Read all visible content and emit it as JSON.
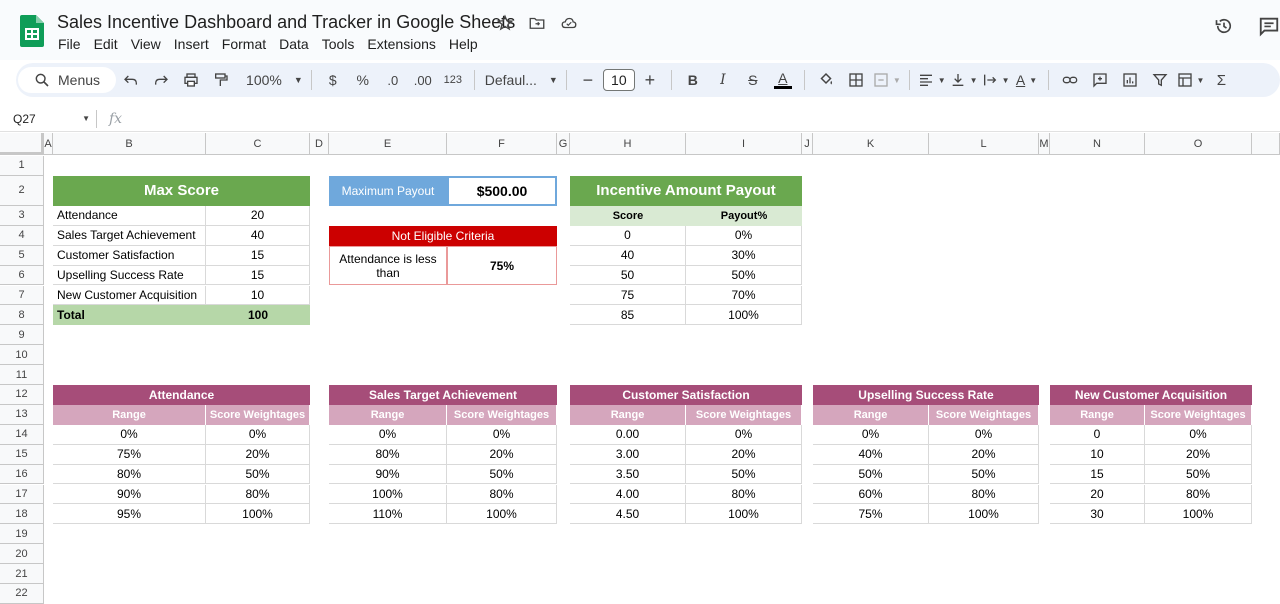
{
  "app": {
    "title": "Sales Incentive Dashboard and Tracker in Google Sheets",
    "menus": [
      "File",
      "Edit",
      "View",
      "Insert",
      "Format",
      "Data",
      "Tools",
      "Extensions",
      "Help"
    ]
  },
  "toolbar": {
    "search_label": "Menus",
    "zoom": "100%",
    "currency": "$",
    "percent": "%",
    "dec_decrease": ".0",
    "dec_increase": ".00",
    "number_format": "123",
    "font": "Defaul...",
    "font_size": "10",
    "bold": "B",
    "italic": "I",
    "text_color": "A"
  },
  "formula_bar": {
    "cell_ref": "Q27",
    "fx": "fx"
  },
  "grid": {
    "columns": [
      "A",
      "B",
      "C",
      "D",
      "E",
      "F",
      "G",
      "H",
      "I",
      "J",
      "K",
      "L",
      "M",
      "N",
      "O"
    ],
    "rows": [
      "1",
      "2",
      "3",
      "4",
      "5",
      "6",
      "7",
      "8",
      "9",
      "10",
      "11",
      "12",
      "13",
      "14",
      "15",
      "16",
      "17",
      "18",
      "19",
      "20",
      "21",
      "22"
    ]
  },
  "max_score": {
    "title": "Max Score",
    "rows": [
      {
        "label": "Attendance",
        "value": "20"
      },
      {
        "label": "Sales Target Achievement",
        "value": "40"
      },
      {
        "label": "Customer Satisfaction",
        "value": "15"
      },
      {
        "label": "Upselling Success Rate",
        "value": "15"
      },
      {
        "label": "New Customer Acquisition",
        "value": "10"
      }
    ],
    "total_label": "Total",
    "total_value": "100"
  },
  "max_payout": {
    "label": "Maximum Payout",
    "value": "$500.00"
  },
  "not_eligible": {
    "title": "Not Eligible Criteria",
    "label": "Attendance is less than",
    "value": "75%"
  },
  "incentive": {
    "title": "Incentive Amount Payout",
    "headers": [
      "Score",
      "Payout%"
    ],
    "rows": [
      [
        "0",
        "0%"
      ],
      [
        "40",
        "30%"
      ],
      [
        "50",
        "50%"
      ],
      [
        "75",
        "70%"
      ],
      [
        "85",
        "100%"
      ]
    ]
  },
  "weight_tables": [
    {
      "title": "Attendance",
      "headers": [
        "Range",
        "Score Weightages"
      ],
      "rows": [
        [
          "0%",
          "0%"
        ],
        [
          "75%",
          "20%"
        ],
        [
          "80%",
          "50%"
        ],
        [
          "90%",
          "80%"
        ],
        [
          "95%",
          "100%"
        ]
      ]
    },
    {
      "title": "Sales Target Achievement",
      "headers": [
        "Range",
        "Score Weightages"
      ],
      "rows": [
        [
          "0%",
          "0%"
        ],
        [
          "80%",
          "20%"
        ],
        [
          "90%",
          "50%"
        ],
        [
          "100%",
          "80%"
        ],
        [
          "110%",
          "100%"
        ]
      ]
    },
    {
      "title": "Customer Satisfaction",
      "headers": [
        "Range",
        "Score Weightages"
      ],
      "rows": [
        [
          "0.00",
          "0%"
        ],
        [
          "3.00",
          "20%"
        ],
        [
          "3.50",
          "50%"
        ],
        [
          "4.00",
          "80%"
        ],
        [
          "4.50",
          "100%"
        ]
      ]
    },
    {
      "title": "Upselling Success Rate",
      "headers": [
        "Range",
        "Score Weightages"
      ],
      "rows": [
        [
          "0%",
          "0%"
        ],
        [
          "40%",
          "20%"
        ],
        [
          "50%",
          "50%"
        ],
        [
          "60%",
          "80%"
        ],
        [
          "75%",
          "100%"
        ]
      ]
    },
    {
      "title": "New Customer Acquisition",
      "headers": [
        "Range",
        "Score Weightages"
      ],
      "rows": [
        [
          "0",
          "0%"
        ],
        [
          "10",
          "20%"
        ],
        [
          "15",
          "50%"
        ],
        [
          "20",
          "80%"
        ],
        [
          "30",
          "100%"
        ]
      ]
    }
  ],
  "colors": {
    "green": "#6aa84f",
    "pink": "#a64d79",
    "light_pink": "#d5a6bd",
    "blue": "#6fa8dc",
    "red": "#cc0000"
  }
}
